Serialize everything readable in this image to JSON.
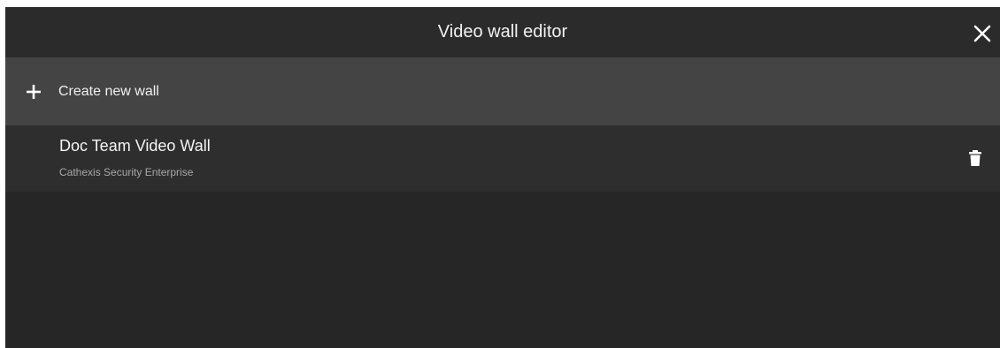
{
  "dialog": {
    "title": "Video wall editor",
    "close_icon": "close-icon"
  },
  "create": {
    "label": "Create new wall",
    "icon": "plus-icon"
  },
  "walls": [
    {
      "name": "Doc Team Video Wall",
      "server": "Cathexis Security Enterprise",
      "delete_icon": "trash-icon"
    }
  ],
  "colors": {
    "dialog_bg": "#262626",
    "header_bg": "#2b2b2b",
    "create_row_bg": "#444444",
    "item_bg": "#2e2e2e",
    "text": "#f2f2f2",
    "subtext": "#a8a8a8"
  }
}
